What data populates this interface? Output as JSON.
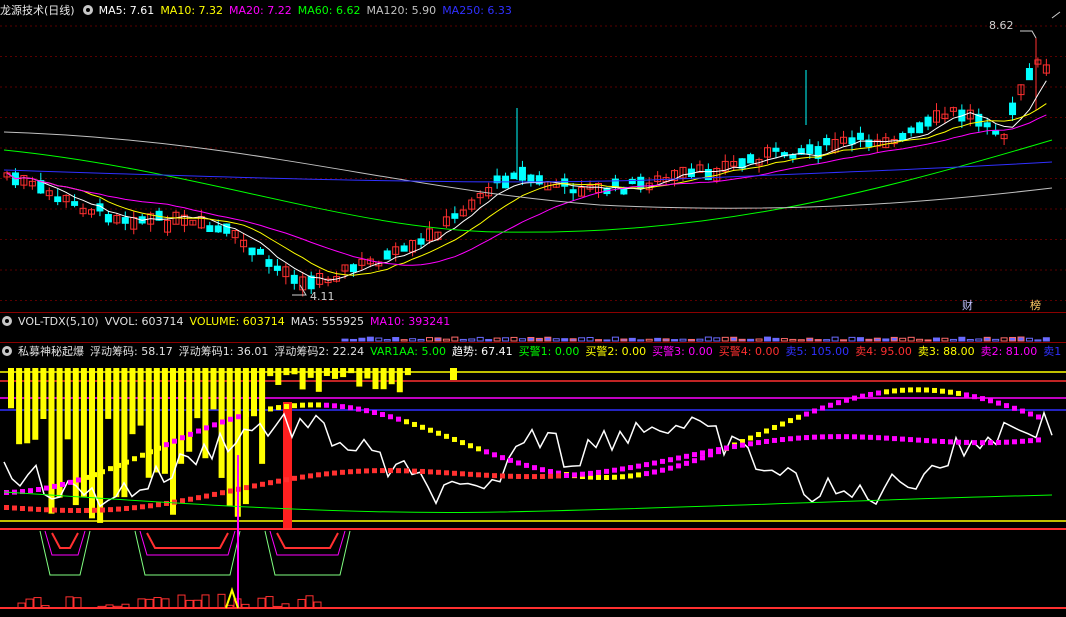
{
  "main": {
    "title": "龙源技术(日线)",
    "ma5": "MA5: 7.61",
    "ma10": "MA10: 7.32",
    "ma20": "MA20: 7.22",
    "ma60": "MA60: 6.62",
    "ma120": "MA120: 5.90",
    "ma250": "MA250: 6.33",
    "high_label": "8.62",
    "low_label": "4.11",
    "tag_cai": "财",
    "tag_bang": "榜",
    "colors": {
      "ma5": "#ffffff",
      "ma10": "#ffff00",
      "ma20": "#ff00ff",
      "ma60": "#00ff00",
      "ma120": "#c0c0c0",
      "ma250": "#3030ff",
      "up": "#ff3030",
      "down": "#00ffff"
    }
  },
  "vol": {
    "name": "VOL-TDX(5,10)",
    "vvol": "VVOL: 603714",
    "volume": "VOLUME: 603714",
    "ma5": "MA5: 555925",
    "ma10": "MA10: 393241"
  },
  "ind": {
    "name": "私募神秘起爆",
    "items": [
      {
        "text": "浮动筹码: 58.17",
        "color": "#e0e0e0"
      },
      {
        "text": "浮动筹码1: 36.01",
        "color": "#e0e0e0"
      },
      {
        "text": "浮动筹码2: 22.24",
        "color": "#e0e0e0"
      },
      {
        "text": "VAR1AA: 5.00",
        "color": "#00ff00"
      },
      {
        "text": "趋势: 67.41",
        "color": "#ffffff"
      },
      {
        "text": "买警1: 0.00",
        "color": "#00ff00"
      },
      {
        "text": "买警2: 0.00",
        "color": "#ffff00"
      },
      {
        "text": "买警3: 0.00",
        "color": "#ff00ff"
      },
      {
        "text": "买警4: 0.00",
        "color": "#ff3030"
      },
      {
        "text": "卖5: 105.00",
        "color": "#3030ff"
      },
      {
        "text": "卖4: 95.00",
        "color": "#ff3030"
      },
      {
        "text": "卖3: 88.00",
        "color": "#ffff00"
      },
      {
        "text": "卖2: 81.00",
        "color": "#ff00ff"
      },
      {
        "text": "卖1",
        "color": "#3030ff"
      }
    ]
  }
}
